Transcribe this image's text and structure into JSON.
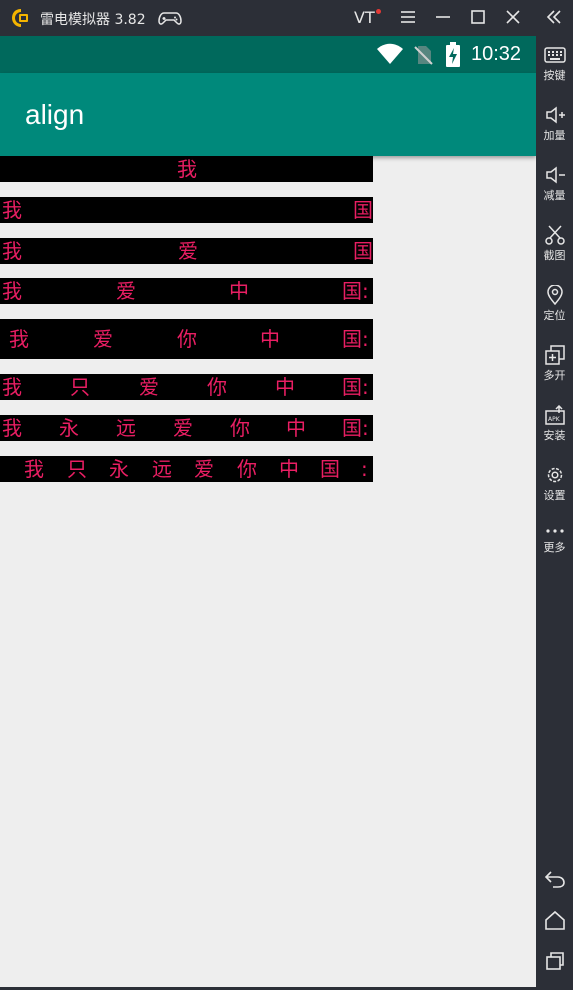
{
  "window": {
    "title": "雷电模拟器 3.82",
    "vt_label": "VT",
    "icons": [
      "ldplayer-logo-icon",
      "gamepad-icon",
      "menu-icon",
      "minimize-icon",
      "maximize-icon",
      "close-icon",
      "collapse-sidebar-icon"
    ]
  },
  "status_bar": {
    "time": "10:32",
    "icons": [
      "wifi-icon",
      "no-sim-icon",
      "battery-charging-icon"
    ]
  },
  "app_bar": {
    "title": "align"
  },
  "rows": [
    {
      "chars": [
        "我"
      ]
    },
    {
      "chars": [
        "我",
        "国"
      ]
    },
    {
      "chars": [
        "我",
        "爱",
        "国"
      ]
    },
    {
      "chars": [
        "我",
        "爱",
        "中",
        "国:"
      ]
    },
    {
      "chars": [
        "我",
        "爱",
        "你",
        "中",
        "国:"
      ]
    },
    {
      "chars": [
        "我",
        "只",
        "爱",
        "你",
        "中",
        "国:"
      ]
    },
    {
      "chars": [
        "我",
        "永",
        "远",
        "爱",
        "你",
        "中",
        "国:"
      ]
    },
    {
      "chars": [
        "我",
        "只",
        "永",
        "远",
        "爱",
        "你",
        "中",
        "国",
        ":"
      ]
    }
  ],
  "sidebar": {
    "items": [
      {
        "label": "按键",
        "icon": "keyboard-icon"
      },
      {
        "label": "加量",
        "icon": "volume-up-icon"
      },
      {
        "label": "减量",
        "icon": "volume-down-icon"
      },
      {
        "label": "截图",
        "icon": "scissors-icon"
      },
      {
        "label": "定位",
        "icon": "location-icon"
      },
      {
        "label": "多开",
        "icon": "multi-instance-icon"
      },
      {
        "label": "安装",
        "icon": "apk-install-icon"
      },
      {
        "label": "设置",
        "icon": "gear-icon"
      },
      {
        "label": "更多",
        "icon": "more-icon"
      }
    ],
    "nav": [
      "back-icon",
      "home-icon",
      "recents-icon"
    ]
  },
  "colors": {
    "text_pink": "#e91e63",
    "status_bar": "#00695c",
    "app_bar": "#00897b"
  }
}
